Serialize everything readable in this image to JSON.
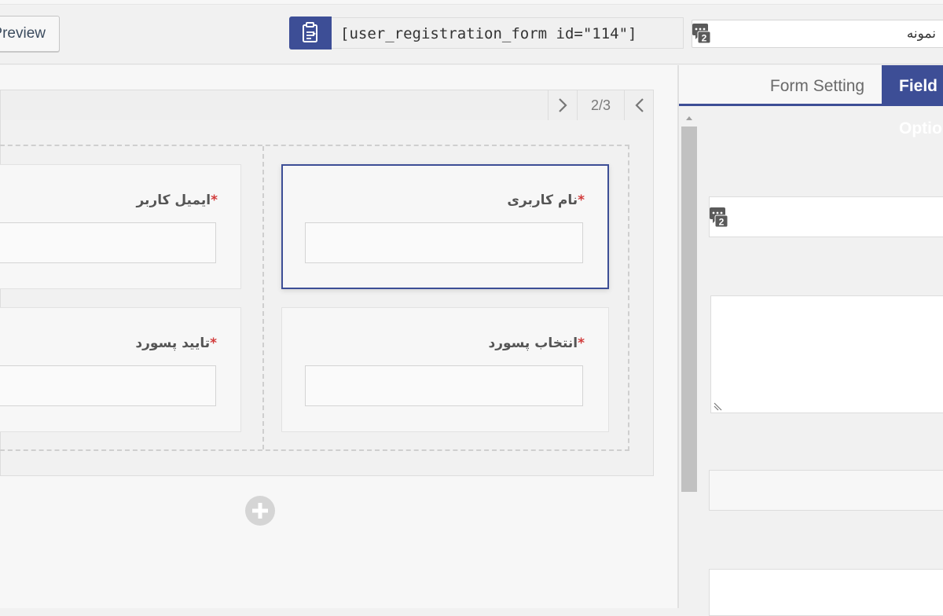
{
  "toolbar": {
    "preview_label": "Preview",
    "shortcode": "[user_registration_form id=\"114\"]",
    "form_title": "نمونه",
    "lang_badge": "2"
  },
  "builder": {
    "page_indicator": "2/3",
    "fields": [
      {
        "label": "نام کاربری",
        "required": "*"
      },
      {
        "label": "ایمیل کاربر",
        "required": "*"
      },
      {
        "label": "انتخاب پسورد",
        "required": "*"
      },
      {
        "label": "تایید پسورد",
        "required": "*"
      }
    ]
  },
  "panel": {
    "tabs": [
      "Form Setting",
      "Field Options"
    ],
    "lang_badge": "2"
  },
  "colors": {
    "accent": "#3d4e96",
    "required": "#d23b3b"
  }
}
